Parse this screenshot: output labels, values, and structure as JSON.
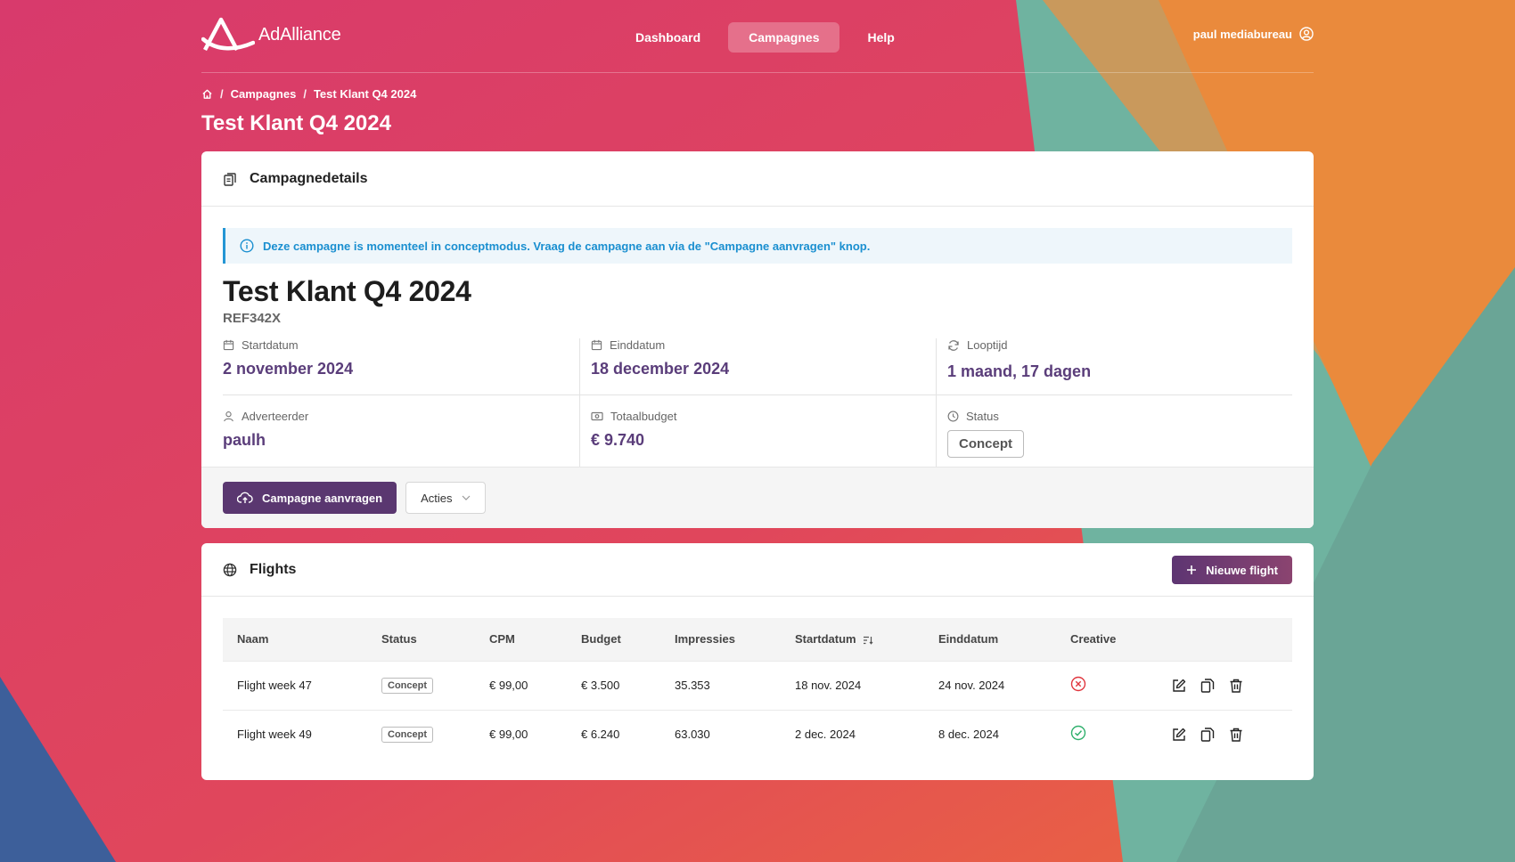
{
  "brand": {
    "name": "AdAlliance"
  },
  "nav": {
    "items": [
      {
        "label": "Dashboard",
        "active": false
      },
      {
        "label": "Campagnes",
        "active": true
      },
      {
        "label": "Help",
        "active": false
      }
    ]
  },
  "user": {
    "name": "paul mediabureau",
    "icon": "user-circle-icon"
  },
  "breadcrumb": {
    "items": [
      "Campagnes",
      "Test Klant Q4 2024"
    ],
    "home_icon": "home-icon"
  },
  "page": {
    "title": "Test Klant Q4 2024"
  },
  "details": {
    "header": "Campagnedetails",
    "alert": "Deze campagne is momenteel in conceptmodus. Vraag de campagne aan via de \"Campagne aanvragen\" knop.",
    "title": "Test Klant Q4 2024",
    "reference": "REF342X",
    "fields": {
      "start": {
        "label": "Startdatum",
        "value": "2 november 2024",
        "icon": "calendar-icon"
      },
      "end": {
        "label": "Einddatum",
        "value": "18 december 2024",
        "icon": "calendar-icon"
      },
      "duration": {
        "label": "Looptijd",
        "value": "1 maand, 17 dagen",
        "icon": "refresh-icon"
      },
      "advertiser": {
        "label": "Adverteerder",
        "value": "paulh",
        "icon": "person-icon"
      },
      "budget": {
        "label": "Totaalbudget",
        "value": "€ 9.740",
        "icon": "money-icon"
      },
      "status": {
        "label": "Status",
        "value": "Concept",
        "icon": "clock-icon"
      }
    },
    "actions": {
      "request_label": "Campagne aanvragen",
      "menu_label": "Acties"
    }
  },
  "flights": {
    "header": "Flights",
    "new_label": "Nieuwe flight",
    "columns": [
      "Naam",
      "Status",
      "CPM",
      "Budget",
      "Impressies",
      "Startdatum",
      "Einddatum",
      "Creative"
    ],
    "rows": [
      {
        "name": "Flight week 47",
        "status": "Concept",
        "cpm": "€ 99,00",
        "budget": "€ 3.500",
        "impressions": "35.353",
        "start": "18 nov. 2024",
        "end": "24 nov. 2024",
        "creative": "missing"
      },
      {
        "name": "Flight week 49",
        "status": "Concept",
        "cpm": "€ 99,00",
        "budget": "€ 6.240",
        "impressions": "63.030",
        "start": "2 dec. 2024",
        "end": "8 dec. 2024",
        "creative": "ok"
      }
    ]
  },
  "colors": {
    "accent": "#5a3770",
    "value_text": "#5a3d7a",
    "info": "#1a8fd0",
    "error": "#e0363e",
    "success": "#2fb06c"
  }
}
